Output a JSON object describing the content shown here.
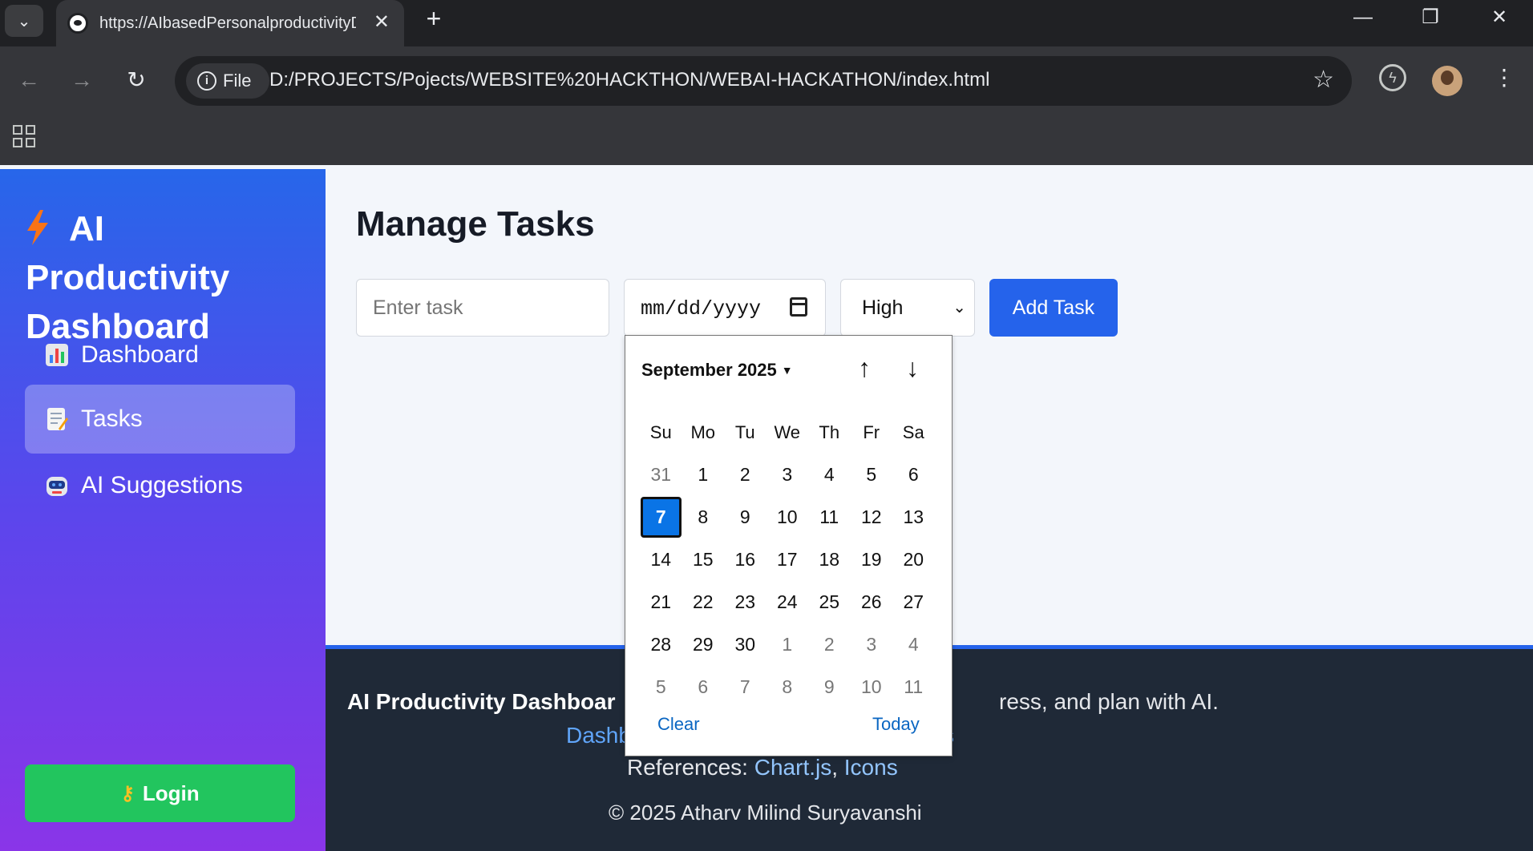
{
  "browser": {
    "tab_title": "https://AIbasedPersonalproductivityDashboard",
    "chip_label": "File",
    "url": "D:/PROJECTS/Pojects/WEBSITE%20HACKTHON/WEBAI-HACKATHON/index.html"
  },
  "sidebar": {
    "brand": "AI Productivity Dashboard",
    "items": [
      {
        "label": "Dashboard"
      },
      {
        "label": "Tasks"
      },
      {
        "label": "AI Suggestions"
      }
    ],
    "login_label": "Login"
  },
  "main": {
    "title": "Manage Tasks",
    "task_placeholder": "Enter task",
    "date_placeholder": "mm/dd/yyyy",
    "priority_value": "High",
    "add_button": "Add Task"
  },
  "calendar": {
    "month_label": "September 2025",
    "weekdays": [
      "Su",
      "Mo",
      "Tu",
      "We",
      "Th",
      "Fr",
      "Sa"
    ],
    "days": [
      "31",
      "1",
      "2",
      "3",
      "4",
      "5",
      "6",
      "7",
      "8",
      "9",
      "10",
      "11",
      "12",
      "13",
      "14",
      "15",
      "16",
      "17",
      "18",
      "19",
      "20",
      "21",
      "22",
      "23",
      "24",
      "25",
      "26",
      "27",
      "28",
      "29",
      "30",
      "1",
      "2",
      "3",
      "4",
      "5",
      "6",
      "7",
      "8",
      "9",
      "10",
      "11"
    ],
    "selected_day": "7",
    "clear_label": "Clear",
    "today_label": "Today"
  },
  "footer": {
    "title_bold": "AI Productivity Dashboar",
    "title_rest": "ress, and plan with AI.",
    "link_left": "Dashb",
    "link_right": "s",
    "refs_label": "References:",
    "ref_chart": "Chart.js",
    "ref_icons": "Icons",
    "copyright": "© 2025 Atharv Milind Suryavanshi"
  },
  "colors": {
    "accent": "#2563eb",
    "login": "#22c55e",
    "footer_bg": "#1f2937",
    "selected_day": "#0a74e6"
  }
}
